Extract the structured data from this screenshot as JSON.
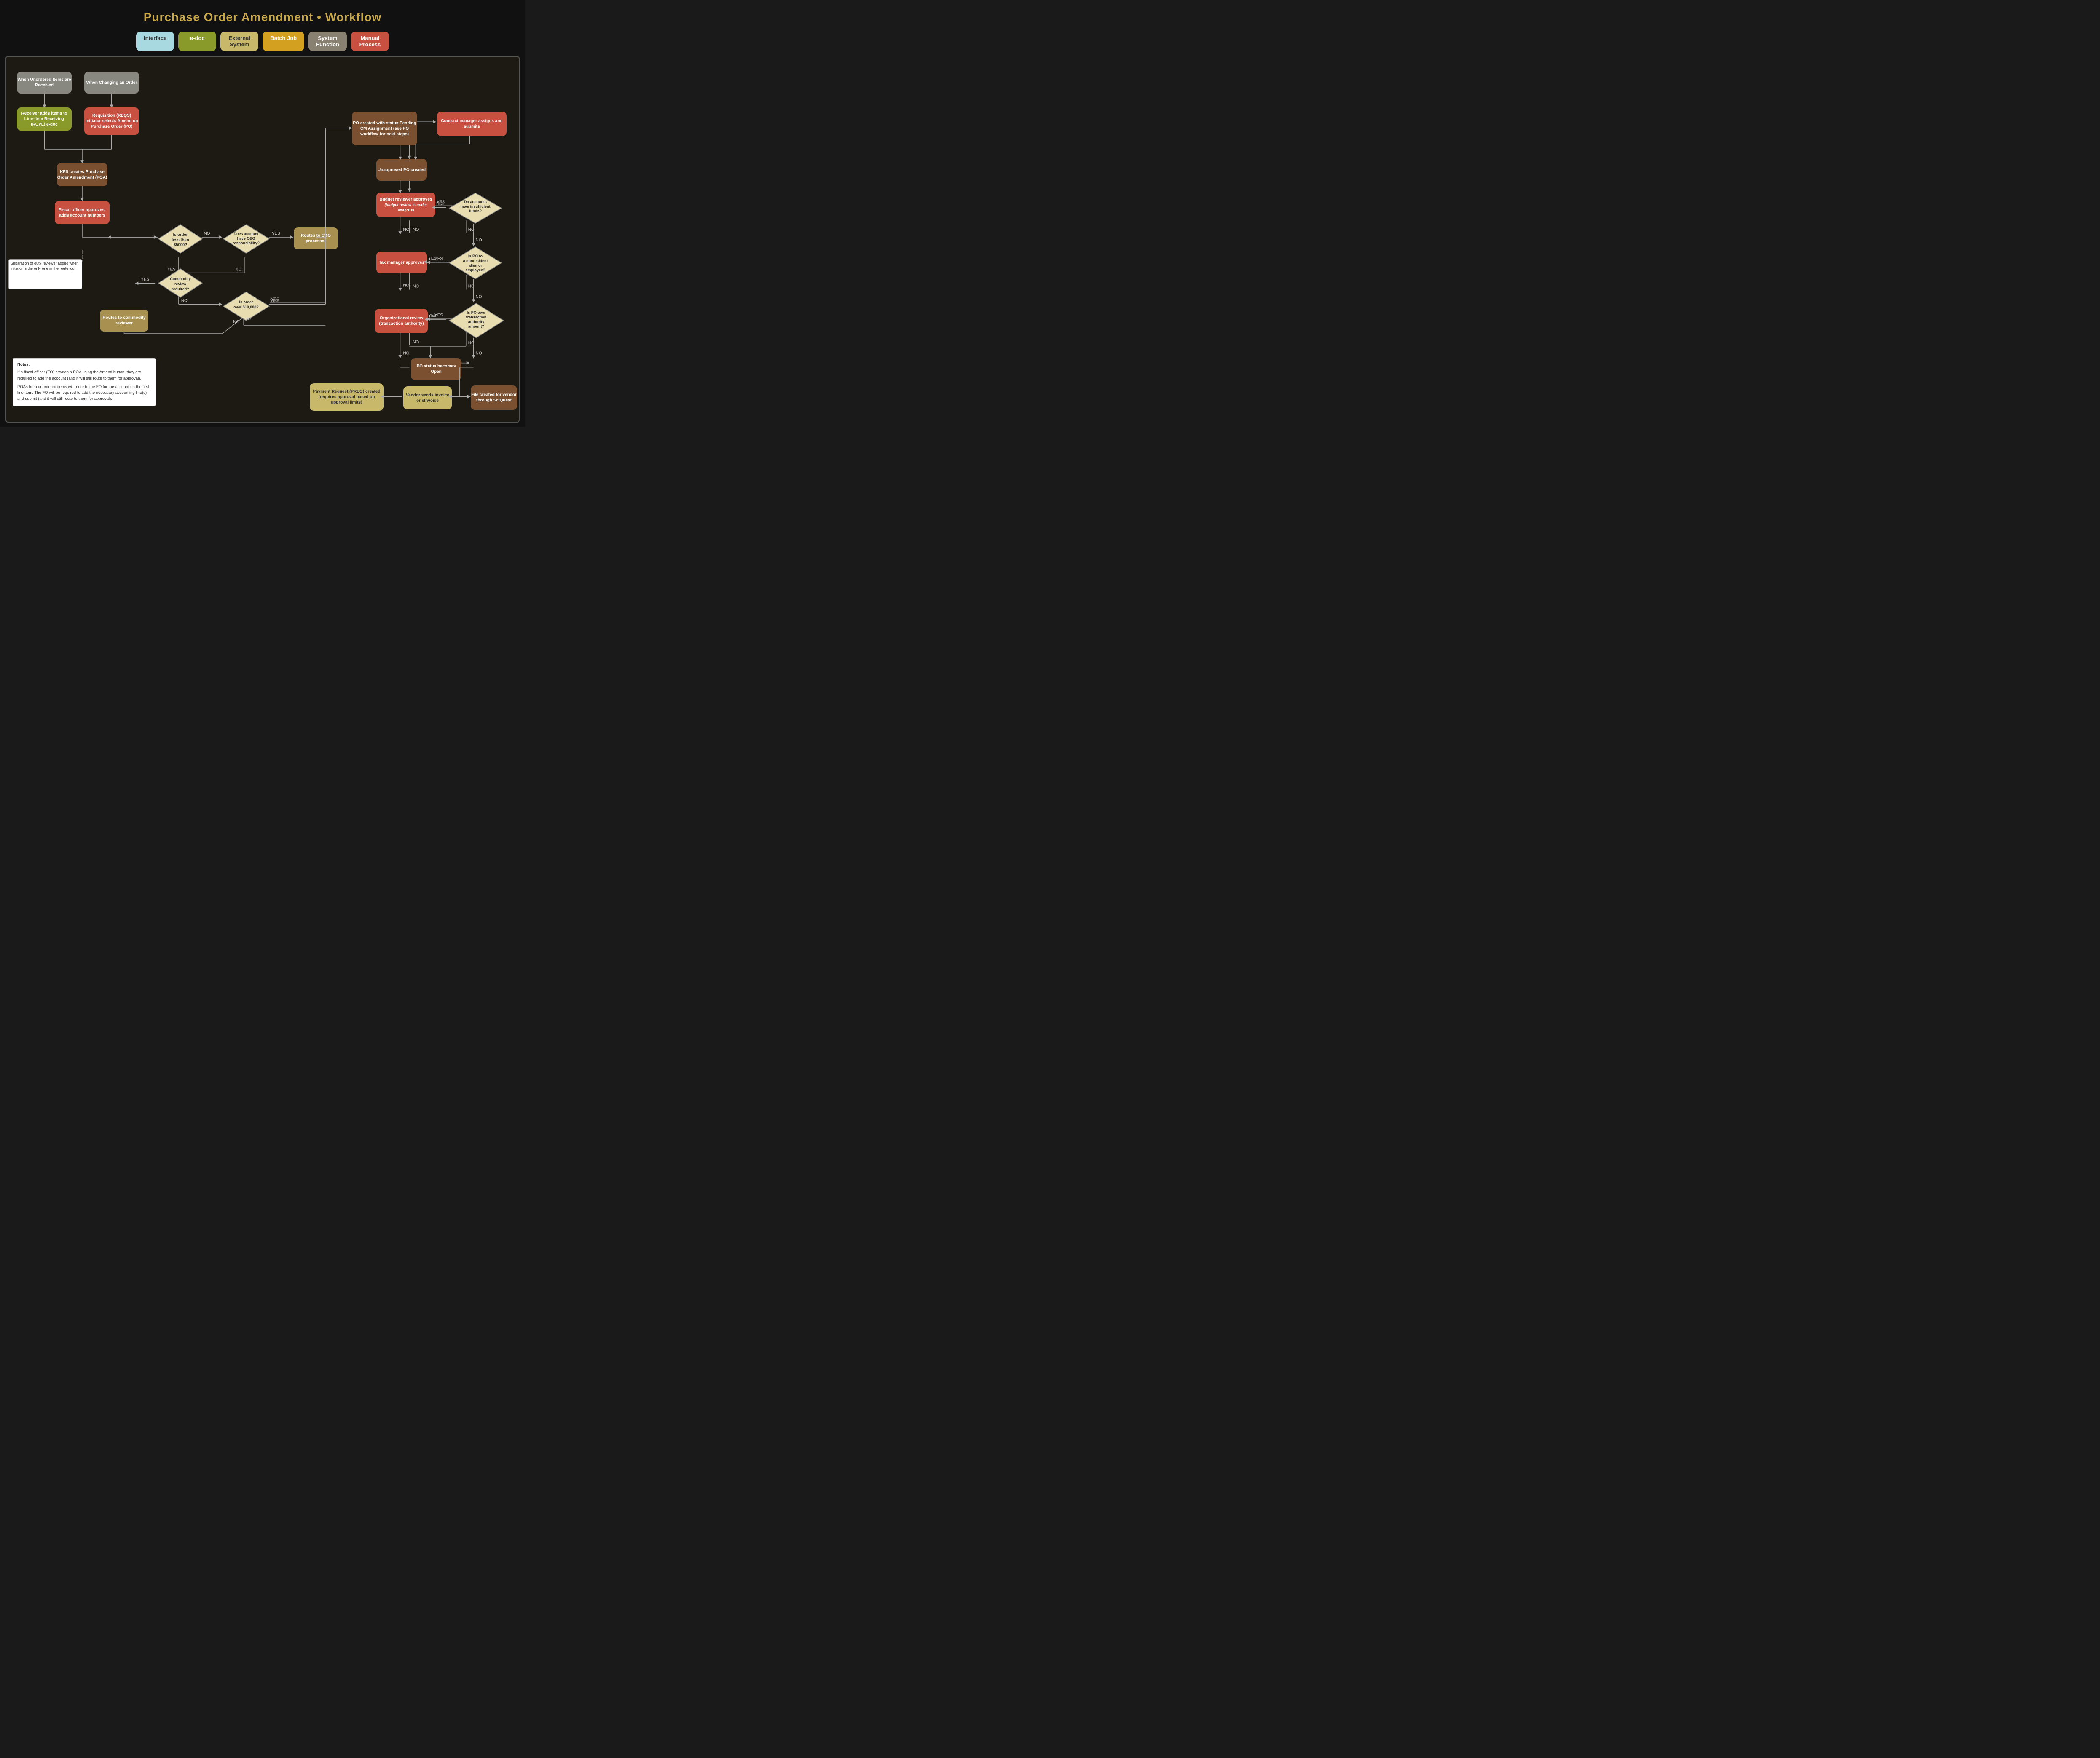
{
  "title": "Purchase Order Amendment • Workflow",
  "legend": [
    {
      "label": "Interface",
      "class": "legend-interface"
    },
    {
      "label": "e-doc",
      "class": "legend-edoc"
    },
    {
      "label": "External\nSystem",
      "class": "legend-external"
    },
    {
      "label": "Batch Job",
      "class": "legend-batch"
    },
    {
      "label": "System\nFunction",
      "class": "legend-system"
    },
    {
      "label": "Manual\nProcess",
      "class": "legend-manual"
    }
  ],
  "notes": {
    "title": "Notes:",
    "line1": "If a fiscal officer (FO) creates a POA using the Amend button, they are required to add the account (and it will still route to them for approval).",
    "line2": "POAs from unordered items will route to the FO for the account on the first line item. The FO will be required to add the necessary accounting line(s) and submit (and it will still route to them for approval)."
  },
  "shapes": {
    "when_unordered": "When Unordered Items are Received",
    "when_changing": "When Changing an Order",
    "receiver_adds": "Receiver adds items to Line-Item Receiving (RCVL) e-doc",
    "requisition": "Requisition (REQS) initiator selects Amend on Purchase Order (PO)",
    "kfs_creates": "KFS creates Purchase Order Amendment (POA)",
    "fiscal_officer": "Fiscal officer approves; adds account numbers",
    "separation": "Separation of duty reviewer added when initiator is the only one in the route log.",
    "is_order_less": "Is order less than $5000?",
    "does_account": "Does account have C&G responsibility?",
    "routes_cg": "Routes to C&G processor",
    "commodity_review": "Commodity review required?",
    "routes_commodity": "Routes to commodity reviewer",
    "is_order_over": "Is order over $10,000?",
    "po_created": "PO created with status Pending CM Assignment (see PO workflow for next steps)",
    "contract_manager": "Contract manager assigns and submits",
    "unapproved_po": "Unapproved PO created",
    "budget_reviewer": "Budget reviewer approves (budget review is under analysis)",
    "do_accounts": "Do accounts have insufficient funds?",
    "tax_manager": "Tax manager approves",
    "is_po_nonresident": "Is PO to a nonresident alien or employee?",
    "organizational": "Organizational review (transaction authority)",
    "is_po_over": "Is PO over transaction authority amount?",
    "po_status": "PO status becomes Open",
    "file_created": "File created for vendor through SciQuest",
    "vendor_sends": "Vendor sends invoice or eInvoice",
    "payment_request": "Payment Request (PREQ) created (requires approval based on approval limits)"
  }
}
